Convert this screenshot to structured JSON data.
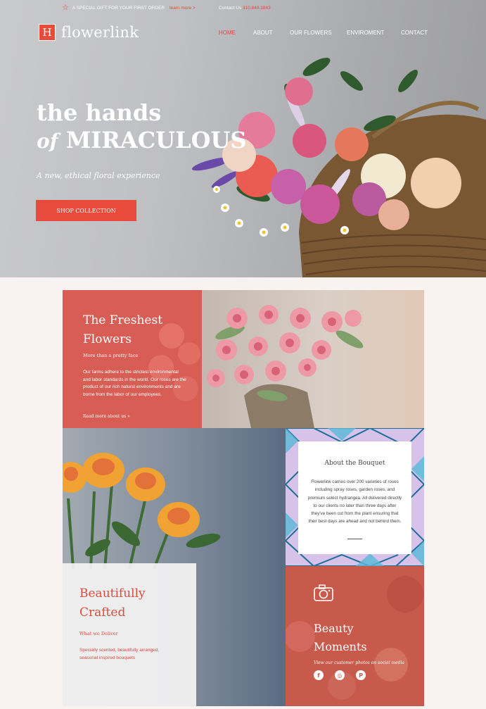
{
  "topbar": {
    "gift_text": "A SPECIAL GIFT FOR YOUR FIRST ORDER",
    "learn_more": "learn more >",
    "contact_label": "Contact Us",
    "phone": "310.848.1843"
  },
  "brand": {
    "mark": "H",
    "name": "flowerlink"
  },
  "nav": [
    "HOME",
    "ABOUT",
    "OUR FLOWERS",
    "ENVIROMENT",
    "CONTACT"
  ],
  "hero": {
    "title_line1": "the hands",
    "title_of": "of",
    "title_line2": "MIRACULOUS",
    "subtitle": "A new, ethical floral experience",
    "cta": "SHOP COLLECTION"
  },
  "fresh": {
    "title": "The Freshest Flowers",
    "subtitle": "More than a pretty face",
    "body": "Our farms adhere to the strictest environmental and labor standards in the world. Our roses are the product of our rich natural environments and are borne from the labor of our employees.",
    "link": "Read more about us »"
  },
  "about": {
    "title": "About the Bouquet",
    "body": "Flowerlink carries over 200 varieties of roses including spray roses, garden roses, and premium select hydrangea. All delivered directly to our clients no later than three days after they've been cut from the plant ensuring that their best days are ahead and not behind them."
  },
  "crafted": {
    "title": "Beautifully Crafted",
    "subtitle": "What we Deliver",
    "body": "Specially scented, beautifully arranged, seasonal inspired bouquets"
  },
  "beauty": {
    "title": "Beauty Moments",
    "subtitle": "View our customer photos on social media",
    "socials": [
      "f",
      "◎",
      "P"
    ]
  },
  "colors": {
    "accent": "#e84a3c",
    "fresh_bg": "#d85e55",
    "beauty_bg": "#c85a4b",
    "page_bg": "#f8f2f1"
  }
}
